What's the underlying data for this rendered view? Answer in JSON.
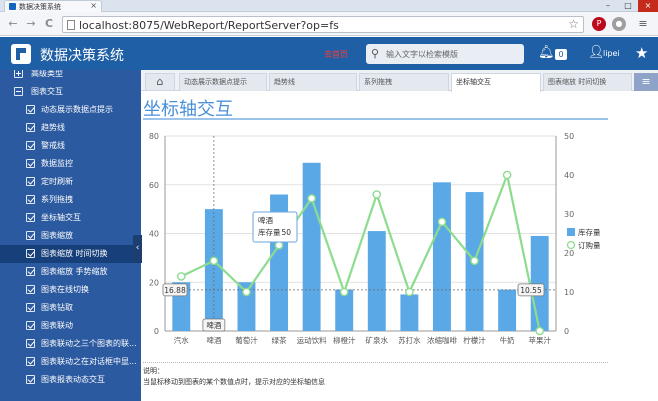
{
  "browser": {
    "tab_title": "数据决策系统",
    "url": "localhost:8075/WebReport/ReportServer?op=fs",
    "nav": {
      "back": "←",
      "forward": "→",
      "reload": "C"
    }
  },
  "header": {
    "app_name": "数据决策系统",
    "red_link": "去首页",
    "search_placeholder": "输入文字以检索模版",
    "notification_count": "0",
    "username": "lipei"
  },
  "sidebar": {
    "items": [
      {
        "label": "高级类型",
        "icon": "plus-box-icon",
        "indent": 0
      },
      {
        "label": "图表交互",
        "icon": "minus-box-icon",
        "indent": 0
      },
      {
        "label": "动态展示数据点提示",
        "icon": "checkbox-icon",
        "indent": 1
      },
      {
        "label": "趋势线",
        "icon": "checkbox-icon",
        "indent": 1
      },
      {
        "label": "警戒线",
        "icon": "checkbox-icon",
        "indent": 1
      },
      {
        "label": "数据监控",
        "icon": "checkbox-icon",
        "indent": 1
      },
      {
        "label": "定时刷新",
        "icon": "checkbox-icon",
        "indent": 1
      },
      {
        "label": "系列拖拽",
        "icon": "checkbox-icon",
        "indent": 1
      },
      {
        "label": "坐标轴交互",
        "icon": "checkbox-icon",
        "indent": 1
      },
      {
        "label": "图表缩放",
        "icon": "checkbox-icon",
        "indent": 1
      },
      {
        "label": "图表缩放 时间切换",
        "icon": "checkbox-icon",
        "indent": 1,
        "active": true
      },
      {
        "label": "图表缩放 手势缩放",
        "icon": "checkbox-icon",
        "indent": 1
      },
      {
        "label": "图表在线切换",
        "icon": "checkbox-icon",
        "indent": 1
      },
      {
        "label": "图表钻取",
        "icon": "checkbox-icon",
        "indent": 1
      },
      {
        "label": "图表联动",
        "icon": "checkbox-icon",
        "indent": 1
      },
      {
        "label": "图表联动之三个图表的联...",
        "icon": "checkbox-icon",
        "indent": 1
      },
      {
        "label": "图表联动之在对话框中显...",
        "icon": "checkbox-icon",
        "indent": 1
      },
      {
        "label": "图表报表动态交互",
        "icon": "checkbox-icon",
        "indent": 1
      }
    ]
  },
  "content_tabs": [
    {
      "label": "动态展示数据点提示"
    },
    {
      "label": "趋势线"
    },
    {
      "label": "系列拖拽"
    },
    {
      "label": "坐标轴交互",
      "active": true
    },
    {
      "label": "图表缩放 时间切换"
    }
  ],
  "report": {
    "title": "坐标轴交互",
    "note_title": "说明：",
    "note_text": "当鼠标移动到图表的某个数值点时，提示对应的坐标轴信息"
  },
  "tooltip": {
    "category": "啤酒",
    "series_label": "库存量",
    "value": "50"
  },
  "axis_pointer": {
    "x_label": "啤酒",
    "y_left_label": "16.88",
    "y_right_label": "10.55"
  },
  "colors": {
    "bar": "#5aa9e6",
    "line": "#8ddc8e",
    "header": "#1f5fa5",
    "sidebar": "#2c5aa0",
    "sidebar_active": "#173f7a",
    "title": "#4a90d9"
  },
  "chart_data": {
    "type": "bar",
    "categories": [
      "汽水",
      "啤酒",
      "葡萄汁",
      "绿茶",
      "运动饮料",
      "柳橙汁",
      "矿泉水",
      "苏打水",
      "浓缩咖啡",
      "柠檬汁",
      "牛奶",
      "苹果汁"
    ],
    "series": [
      {
        "name": "库存量",
        "type": "bar",
        "axis": "left",
        "values": [
          20,
          50,
          20,
          56,
          69,
          17,
          41,
          15,
          61,
          57,
          17,
          39
        ]
      },
      {
        "name": "订购量",
        "type": "line",
        "axis": "right",
        "values": [
          14,
          18,
          10,
          22,
          34,
          10,
          35,
          10,
          28,
          18,
          40,
          0
        ]
      }
    ],
    "y_left": {
      "min": 0,
      "max": 80,
      "ticks": [
        0,
        20,
        40,
        60,
        80
      ]
    },
    "y_right": {
      "min": 0,
      "max": 50,
      "ticks": [
        0,
        10,
        20,
        30,
        40,
        50
      ]
    },
    "legend": "right",
    "grid": true
  }
}
